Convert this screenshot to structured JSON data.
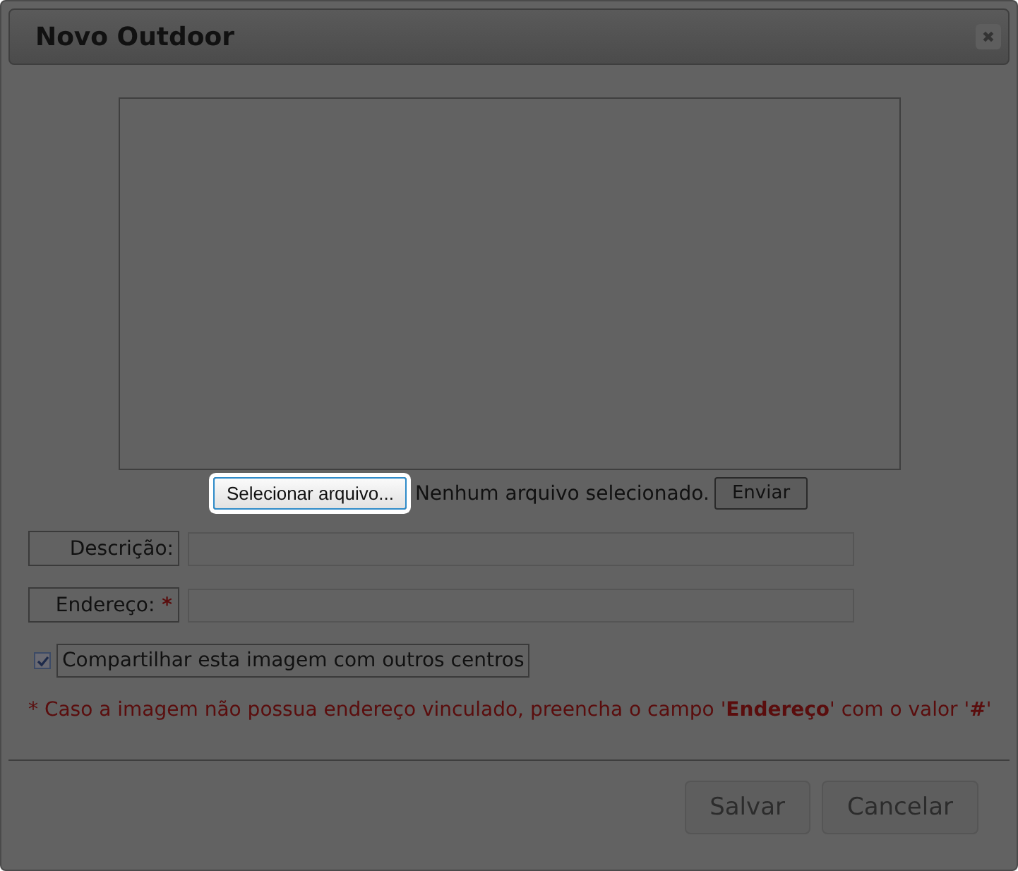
{
  "dialog": {
    "title": "Novo Outdoor",
    "close_icon": "✖"
  },
  "upload": {
    "select_button": "Selecionar arquivo...",
    "file_status": "Nenhum arquivo selecionado.",
    "send_button": "Enviar"
  },
  "fields": [
    {
      "label": "Descrição:",
      "required": false
    },
    {
      "label": "Endereço:",
      "required": true,
      "required_mark": "*"
    }
  ],
  "share": {
    "label": "Compartilhar esta imagem com outros centros",
    "checked": true
  },
  "note": "* Caso a imagem não possua endereço vinculado, preencha o campo '**Endereço**' com o valor '**#**'",
  "buttons": [
    "Salvar",
    "Cancelar"
  ]
}
